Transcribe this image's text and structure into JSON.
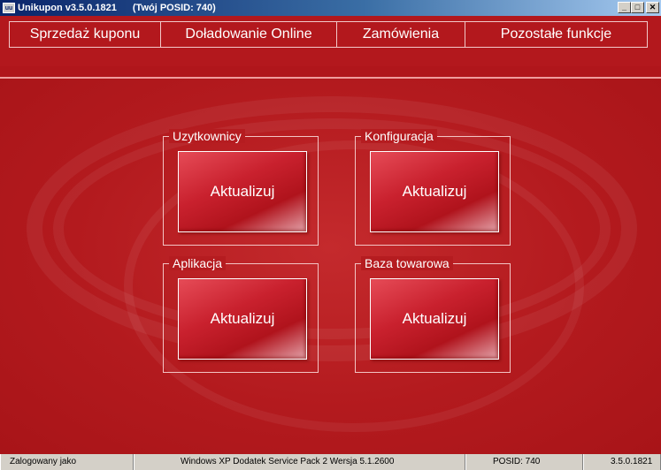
{
  "window": {
    "app_icon": "uu",
    "title": "Unikupon v3.5.0.1821",
    "posid_label": "(Twój POSID: 740)",
    "controls": [
      "minimize-icon",
      "maximize-icon",
      "close-icon"
    ]
  },
  "menu": [
    {
      "label": "Sprzedaż kuponu"
    },
    {
      "label": "Doładowanie Online"
    },
    {
      "label": "Zamówienia"
    },
    {
      "label": "Pozostałe funkcje"
    }
  ],
  "groups": [
    {
      "title": "Uzytkownicy",
      "button": "Aktualizuj"
    },
    {
      "title": "Konfiguracja",
      "button": "Aktualizuj"
    },
    {
      "title": "Aplikacja",
      "button": "Aktualizuj"
    },
    {
      "title": "Baza towarowa",
      "button": "Aktualizuj"
    }
  ],
  "status": {
    "logged": "Zalogowany jako",
    "os": "Windows XP Dodatek Service Pack 2 Wersja 5.1.2600",
    "posid": "POSID: 740",
    "version": "3.5.0.1821"
  },
  "colors": {
    "background": "#b0161b",
    "button": "#c9212e",
    "titlebar": "#0a246a"
  }
}
